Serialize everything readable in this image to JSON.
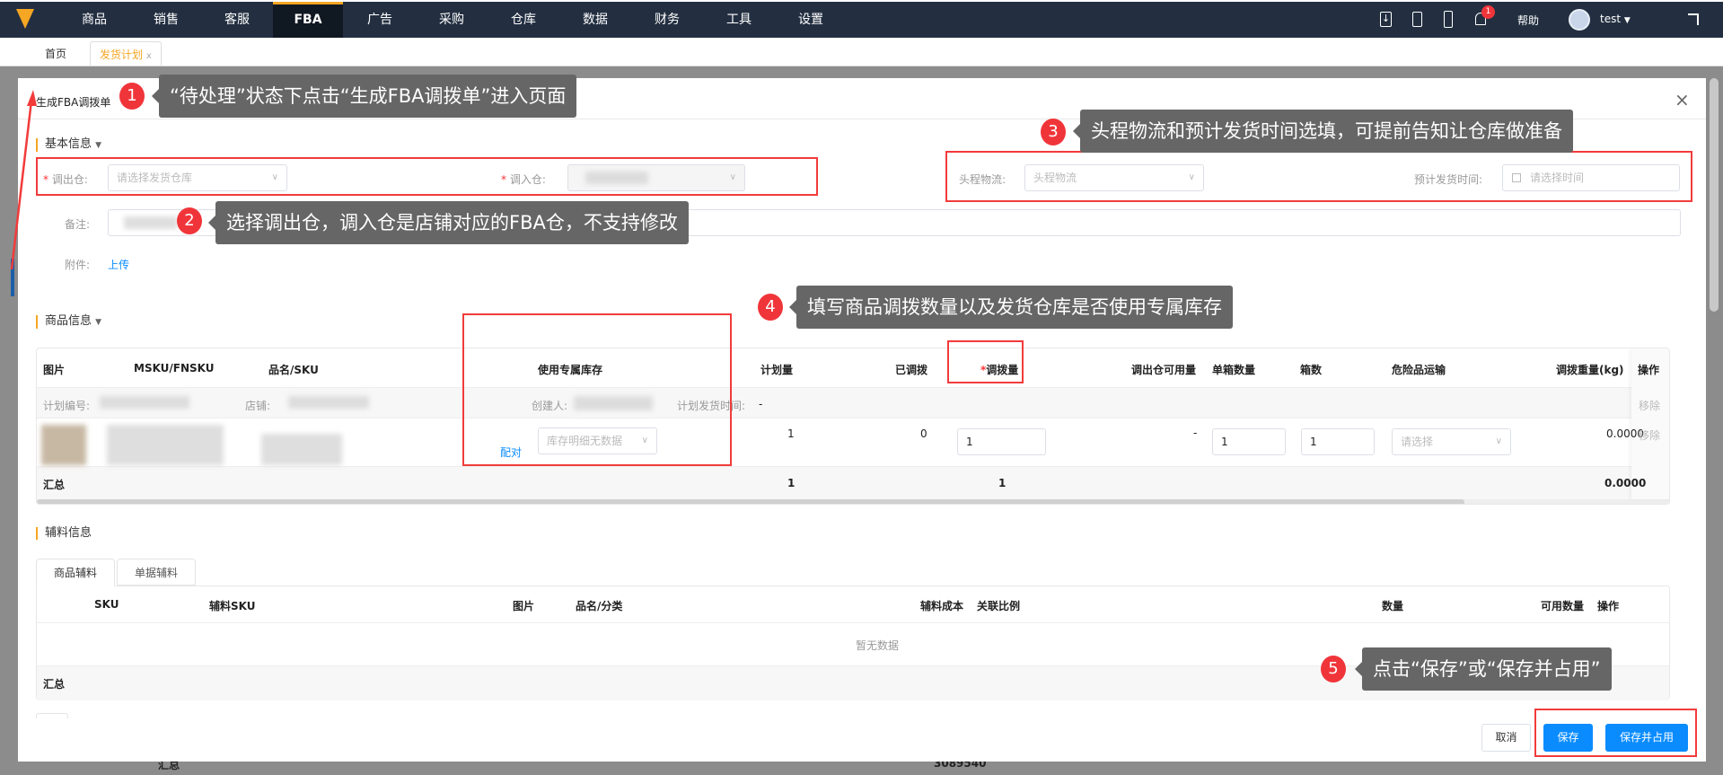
{
  "nav": {
    "items": [
      "商品",
      "销售",
      "客服",
      "FBA",
      "广告",
      "采购",
      "仓库",
      "数据",
      "财务",
      "工具",
      "设置"
    ],
    "active": "FBA",
    "help": "帮助",
    "user": "test",
    "notification_count": "1"
  },
  "tabs": [
    {
      "label": "首页"
    },
    {
      "label": "发货计划",
      "close": "x"
    }
  ],
  "modal": {
    "title": "生成FBA调拨单",
    "close": "×",
    "basic": {
      "title": "基本信息",
      "out_wh_label": "调出仓:",
      "out_wh_placeholder": "请选择发货仓库",
      "in_wh_label": "调入仓:",
      "logistics_label": "头程物流:",
      "logistics_placeholder": "头程物流",
      "ship_time_label": "预计发货时间:",
      "ship_time_placeholder": "请选择时间",
      "remark_label": "备注:",
      "attach_label": "附件:",
      "upload": "上传"
    },
    "goods": {
      "title": "商品信息",
      "headers": [
        "图片",
        "MSKU/FNSKU",
        "品名/SKU",
        "使用专属库存",
        "计划量",
        "已调拨",
        "调拨量",
        "调出仓可用量",
        "单箱数量",
        "箱数",
        "危险品运输",
        "调拨重量(kg)",
        "操作"
      ],
      "group_row": {
        "plan_no_label": "计划编号:",
        "shop_label": "店铺:",
        "creator_label": "创建人:",
        "plan_time_label": "计划发货时间:",
        "plan_time": "-",
        "remove": "移除"
      },
      "row": {
        "match": "配对",
        "stock_placeholder": "库存明细无数据",
        "plan": "1",
        "transferred": "0",
        "qty": "1",
        "available": "-",
        "per_box": "1",
        "boxes": "1",
        "danger_placeholder": "请选择",
        "weight": "0.0000",
        "remove": "移除"
      },
      "total": {
        "label": "汇总",
        "plan": "1",
        "qty": "1",
        "weight": "0.0000"
      }
    },
    "aux": {
      "title": "辅料信息",
      "tabs": [
        "商品辅料",
        "单据辅料"
      ],
      "headers": [
        "SKU",
        "辅料SKU",
        "图片",
        "品名/分类",
        "辅料成本",
        "关联比例",
        "数量",
        "可用数量",
        "操作"
      ],
      "empty": "暂无数据",
      "total": "汇总"
    },
    "footer": {
      "cancel": "取消",
      "save": "保存",
      "save_occupy": "保存并占用"
    }
  },
  "background": {
    "total_label": "汇总",
    "total_value": "3089540"
  },
  "annotations": [
    {
      "n": "1",
      "text": "“待处理”状态下点击“生成FBA调拨单”进入页面"
    },
    {
      "n": "2",
      "text": "选择调出仓，调入仓是店铺对应的FBA仓，不支持修改"
    },
    {
      "n": "3",
      "text": "头程物流和预计发货时间选填，可提前告知让仓库做准备"
    },
    {
      "n": "4",
      "text": "填写商品调拨数量以及发货仓库是否使用专属库存"
    },
    {
      "n": "5",
      "text": "点击“保存”或“保存并占用”"
    }
  ],
  "colors": {
    "accent": "#f5a623",
    "primary": "#0a8cff",
    "annotation": "#f23b3b",
    "nav_bg": "#232f41"
  }
}
